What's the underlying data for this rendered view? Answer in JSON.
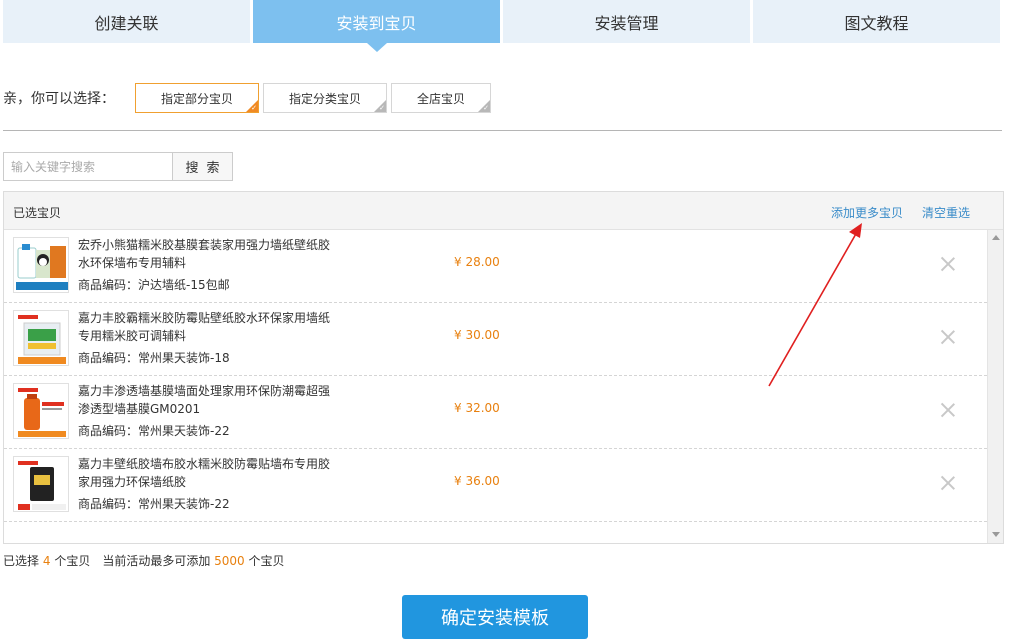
{
  "tabs": [
    {
      "label": "创建关联"
    },
    {
      "label": "安装到宝贝"
    },
    {
      "label": "安装管理"
    },
    {
      "label": "图文教程"
    }
  ],
  "choose": {
    "label": "亲，你可以选择：",
    "options": [
      {
        "label": "指定部分宝贝"
      },
      {
        "label": "指定分类宝贝"
      },
      {
        "label": "全店宝贝"
      }
    ]
  },
  "search": {
    "placeholder": "输入关键字搜索",
    "button_label": "搜索"
  },
  "panel": {
    "title": "已选宝贝",
    "add_more": "添加更多宝贝",
    "clear": "清空重选"
  },
  "items": [
    {
      "title": "宏乔小熊猫糯米胶基膜套装家用强力墙纸壁纸胶水环保墙布专用辅料",
      "code": "商品编码：沪达墙纸-15包邮",
      "price": "¥ 28.00"
    },
    {
      "title": "嘉力丰胶霸糯米胶防霉贴壁纸胶水环保家用墙纸专用糯米胶可调辅料",
      "code": "商品编码：常州果天装饰-18",
      "price": "¥ 30.00"
    },
    {
      "title": "嘉力丰渗透墙基膜墙面处理家用环保防潮霉超强渗透型墙基膜GM0201",
      "code": "商品编码：常州果天装饰-22",
      "price": "¥ 32.00"
    },
    {
      "title": "嘉力丰壁纸胶墙布胶水糯米胶防霉贴墙布专用胶家用强力环保墙纸胶",
      "code": "商品编码：常州果天装饰-22",
      "price": "¥ 36.00"
    }
  ],
  "summary": {
    "prefix": "已选择",
    "count": "4",
    "mid": "个宝贝　当前活动最多可添加",
    "max": "5000",
    "suffix": "个宝贝"
  },
  "confirm_label": "确定安装模板",
  "colors": {
    "tab_active": "#7dc0ef",
    "tab_inactive": "#e8f1f9",
    "accent_orange": "#e8800f",
    "link_blue": "#3a8cc9",
    "button_blue": "#2196df",
    "annotation_red": "#e02020"
  }
}
